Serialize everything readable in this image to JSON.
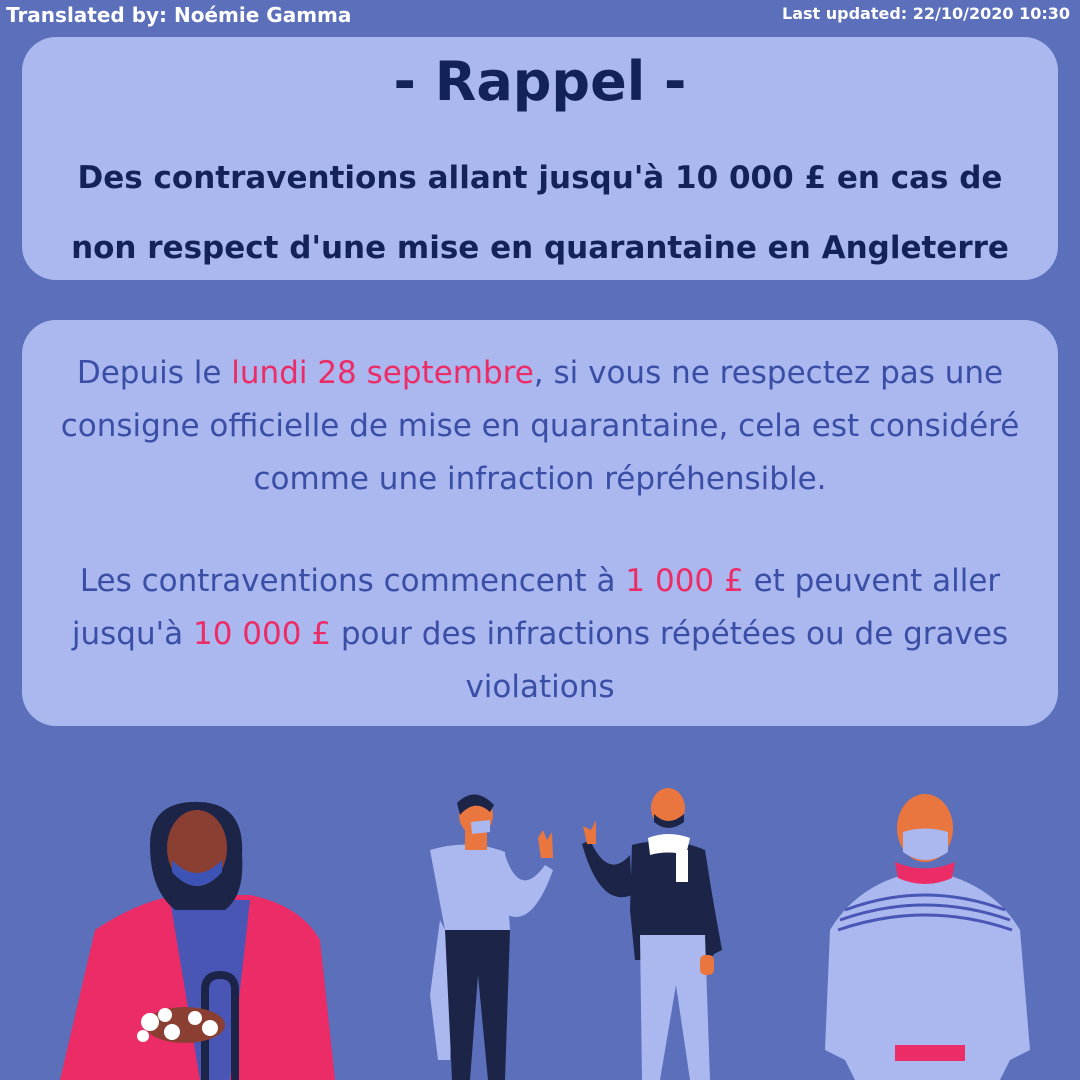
{
  "header": {
    "translated_by": "Translated by: Noémie Gamma",
    "last_updated": "Last updated: 22/10/2020 10:30"
  },
  "reminder": {
    "title": "- Rappel -",
    "subtitle": "Des contraventions allant jusqu'à 10 000 £ en cas de non respect d'une mise en quarantaine en Angleterre"
  },
  "body": {
    "p1_before": "Depuis le ",
    "p1_date": "lundi 28 septembre",
    "p1_after": ", si vous ne respectez pas une consigne officielle de mise en quarantaine, cela est considéré comme une infraction répréhensible.",
    "p2_before": "Les contraventions commencent à ",
    "p2_min": "1 000 £",
    "p2_middle": " et peuvent aller jusqu'à ",
    "p2_max": "10 000 £",
    "p2_after": " pour des infractions répétées ou de graves violations"
  },
  "colors": {
    "background": "#5b6fbb",
    "card": "#aab8ef",
    "title": "#132258",
    "body_text": "#3a4ea6",
    "highlight": "#ec2c66"
  },
  "illustration": {
    "icons": [
      "woman-washing-hands-icon",
      "man-in-mask-waving-icon",
      "man-with-scarf-waving-icon",
      "man-in-sweater-icon"
    ]
  }
}
